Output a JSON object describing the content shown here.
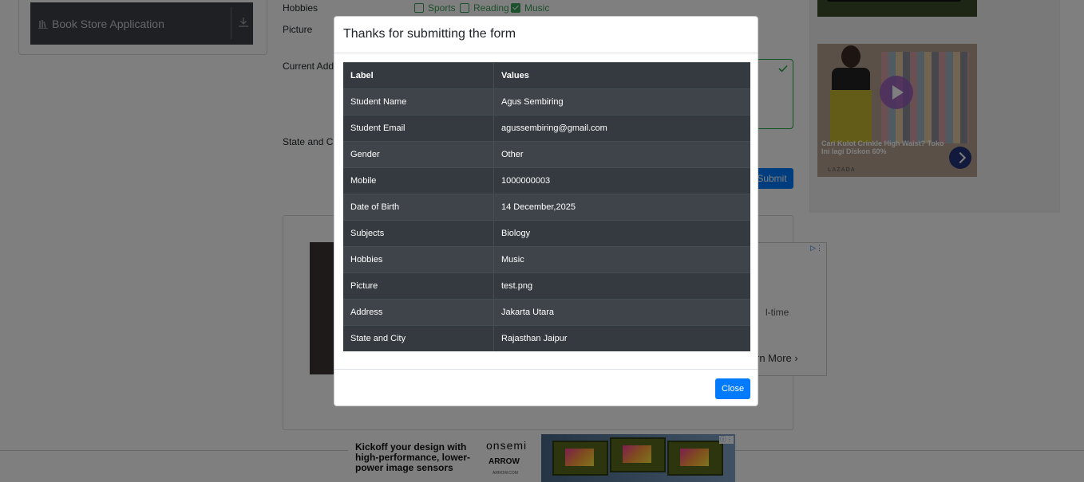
{
  "sidebar": {
    "book_store": "Book Store Application"
  },
  "form": {
    "hobbies_label": "Hobbies",
    "hobbies": [
      {
        "label": "Sports",
        "checked": false
      },
      {
        "label": "Reading",
        "checked": false
      },
      {
        "label": "Music",
        "checked": true
      }
    ],
    "picture_label": "Picture",
    "address_label": "Current Addre",
    "state_city_label": "State and City",
    "submit_label": "Submit"
  },
  "ads": {
    "right_panel_text": "l-time",
    "right_panel_cta": "rn More",
    "lazada_caption": "Cari Kulot Crinkle High Waist? Toko Ini lagi Diskon 60%",
    "lazada_brand": "LAZADA",
    "bottom_copy": "Kickoff your design with high-performance, lower-power image sensors",
    "bottom_brand1": "onsemi",
    "bottom_brand2": "ARROW",
    "bottom_brand3": "ARROW.COM"
  },
  "modal": {
    "title": "Thanks for submitting the form",
    "header": {
      "label": "Label",
      "values": "Values"
    },
    "rows": [
      {
        "label": "Student Name",
        "value": "Agus Sembiring"
      },
      {
        "label": "Student Email",
        "value": "agussembiring@gmail.com"
      },
      {
        "label": "Gender",
        "value": "Other"
      },
      {
        "label": "Mobile",
        "value": "1000000003"
      },
      {
        "label": "Date of Birth",
        "value": "14 December,2025"
      },
      {
        "label": "Subjects",
        "value": "Biology"
      },
      {
        "label": "Hobbies",
        "value": "Music"
      },
      {
        "label": "Picture",
        "value": "test.png"
      },
      {
        "label": "Address",
        "value": "Jakarta Utara"
      },
      {
        "label": "State and City",
        "value": "Rajasthan Jaipur"
      }
    ],
    "close_label": "Close"
  },
  "colors": {
    "primary": "#007bff",
    "valid_green": "#28a745",
    "table_dark": "#343a40",
    "table_dark_alt": "#3e444a"
  }
}
